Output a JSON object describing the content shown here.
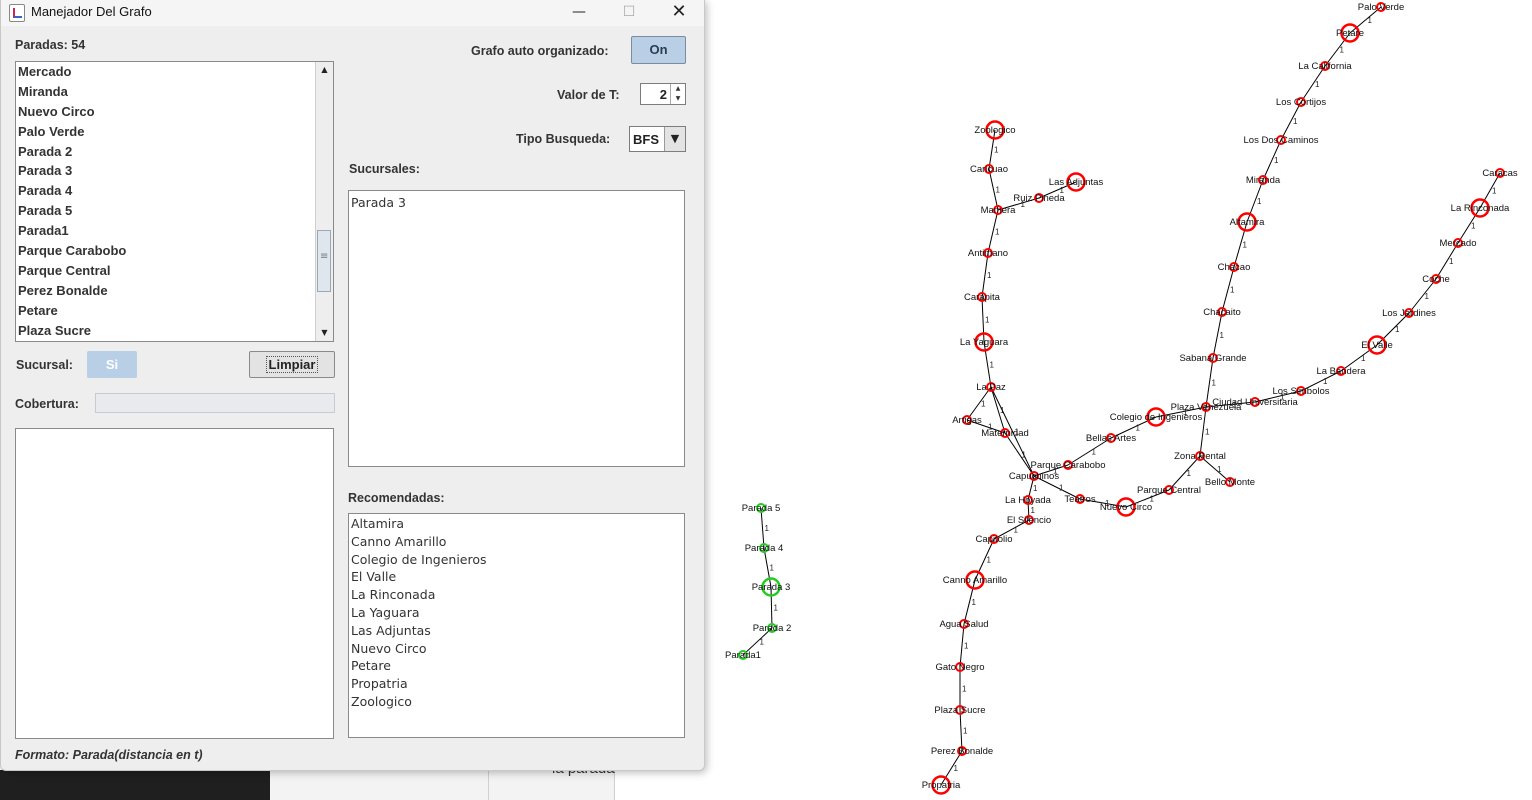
{
  "window": {
    "title": "Manejador Del Grafo",
    "controls": {
      "minimize": "—",
      "maximize": "☐",
      "close": "✕"
    }
  },
  "left": {
    "paradas_label": "Paradas: 54",
    "paradas_items": [
      "Mercado",
      "Miranda",
      "Nuevo Circo",
      "Palo Verde",
      "Parada 2",
      "Parada 3",
      "Parada 4",
      "Parada 5",
      "Parada1",
      "Parque Carabobo",
      "Parque Central",
      "Perez Bonalde",
      "Petare",
      "Plaza Sucre"
    ],
    "sucursal_label": "Sucursal:",
    "si_button": "Si",
    "limpiar_button": "Limpiar",
    "cobertura_label": "Cobertura:",
    "formato_text": "Formato: Parada(distancia en t)"
  },
  "right": {
    "auto_label": "Grafo auto organizado:",
    "auto_button": "On",
    "t_label": "Valor de T:",
    "t_value": "2",
    "tipo_label": "Tipo Busqueda:",
    "tipo_value": "BFS",
    "sucursales_label": "Sucursales:",
    "sucursales_items": [
      "Parada 3"
    ],
    "recomendadas_label": "Recomendadas:",
    "recomendadas_items": [
      "Altamira",
      "Canno Amarillo",
      "Colegio de Ingenieros",
      "El Valle",
      "La Rinconada",
      "La Yaguara",
      "Las Adjuntas",
      "Nuevo Circo",
      "Petare",
      "Propatria",
      "Zoologico"
    ]
  },
  "background": {
    "partial_text": "la parada"
  },
  "graph": {
    "colors": {
      "default": "#ff0000",
      "branch": "#22cc22"
    },
    "nodes": [
      {
        "id": "Palo Verde",
        "label": "Palo Verde",
        "big": false
      },
      {
        "id": "Petare",
        "label": "Petare",
        "big": true
      },
      {
        "id": "La California",
        "label": "La California",
        "big": false
      },
      {
        "id": "Los Cortijos",
        "label": "Los Cortijos",
        "big": false
      },
      {
        "id": "Los Dos Caminos",
        "label": "Los Dos Caminos",
        "big": false
      },
      {
        "id": "Miranda",
        "label": "Miranda",
        "big": false
      },
      {
        "id": "Altamira",
        "label": "Altamira",
        "big": true
      },
      {
        "id": "Chacao",
        "label": "Chacao",
        "big": false
      },
      {
        "id": "Chacaito",
        "label": "Chacaito",
        "big": false
      },
      {
        "id": "Sabana Grande",
        "label": "Sabana Grande",
        "big": false
      },
      {
        "id": "Plaza Venezuela",
        "label": "Plaza Venezuela",
        "big": false
      },
      {
        "id": "Colegio de Ingenieros",
        "label": "Colegio de Ingenieros",
        "big": true
      },
      {
        "id": "Bellas Artes",
        "label": "Bellas Artes",
        "big": false
      },
      {
        "id": "Parque Carabobo",
        "label": "Parque Carabobo",
        "big": false
      },
      {
        "id": "Capuchinos",
        "label": "Capuchinos",
        "big": false
      },
      {
        "id": "La Hoyada",
        "label": "La Hoyada",
        "big": false
      },
      {
        "id": "El Silencio",
        "label": "El Silencio",
        "big": false
      },
      {
        "id": "Capitolio",
        "label": "Capitolio",
        "big": false
      },
      {
        "id": "Canno Amarillo",
        "label": "Canno Amarillo",
        "big": true
      },
      {
        "id": "Agua Salud",
        "label": "Agua Salud",
        "big": false
      },
      {
        "id": "Gato Negro",
        "label": "Gato Negro",
        "big": false
      },
      {
        "id": "Plaza Sucre",
        "label": "Plaza Sucre",
        "big": false
      },
      {
        "id": "Perez Bonalde",
        "label": "Perez Bonalde",
        "big": false
      },
      {
        "id": "Propatria",
        "label": "Propatria",
        "big": true
      },
      {
        "id": "Teatros",
        "label": "Teatros",
        "big": false
      },
      {
        "id": "Nuevo Circo",
        "label": "Nuevo Circo",
        "big": true
      },
      {
        "id": "Parque Central",
        "label": "Parque Central",
        "big": false
      },
      {
        "id": "Zona Rental",
        "label": "Zona Rental",
        "big": false
      },
      {
        "id": "Bello Monte",
        "label": "Bello Monte",
        "big": false
      },
      {
        "id": "Ciudad Universitaria",
        "label": "Ciudad Universitaria",
        "big": false
      },
      {
        "id": "Los Simbolos",
        "label": "Los Simbolos",
        "big": false
      },
      {
        "id": "La Bandera",
        "label": "La Bandera",
        "big": false
      },
      {
        "id": "El Valle",
        "label": "El Valle",
        "big": true
      },
      {
        "id": "Los Jardines",
        "label": "Los Jardines",
        "big": false
      },
      {
        "id": "Coche",
        "label": "Coche",
        "big": false
      },
      {
        "id": "Mercado",
        "label": "Mercado",
        "big": false
      },
      {
        "id": "La Rinconada",
        "label": "La Rinconada",
        "big": true
      },
      {
        "id": "Caracas",
        "label": "Caracas",
        "big": false
      },
      {
        "id": "Zoologico",
        "label": "Zoologico",
        "big": true
      },
      {
        "id": "Caricuao",
        "label": "Caricuao",
        "big": false
      },
      {
        "id": "Mamera",
        "label": "Mamera",
        "big": false
      },
      {
        "id": "Ruiz Pineda",
        "label": "Ruiz Pineda",
        "big": false
      },
      {
        "id": "Las Adjuntas",
        "label": "Las Adjuntas",
        "big": true
      },
      {
        "id": "Antimano",
        "label": "Antimano",
        "big": false
      },
      {
        "id": "Carapita",
        "label": "Carapita",
        "big": false
      },
      {
        "id": "La Yaguara",
        "label": "La Yaguara",
        "big": true
      },
      {
        "id": "La Paz",
        "label": "La Paz",
        "big": false
      },
      {
        "id": "Artigas",
        "label": "Artigas",
        "big": false
      },
      {
        "id": "Maternidad",
        "label": "Maternidad",
        "big": false
      },
      {
        "id": "Parada 5",
        "label": "Parada 5",
        "big": false,
        "green": true
      },
      {
        "id": "Parada 4",
        "label": "Parada 4",
        "big": false,
        "green": true
      },
      {
        "id": "Parada 3",
        "label": "Parada 3",
        "big": true,
        "green": true
      },
      {
        "id": "Parada 2",
        "label": "Parada 2",
        "big": false,
        "green": true
      },
      {
        "id": "Parada1",
        "label": "Parada1",
        "big": false,
        "green": true
      }
    ],
    "edges": [
      [
        "Palo Verde",
        "Petare"
      ],
      [
        "Petare",
        "La California"
      ],
      [
        "La California",
        "Los Cortijos"
      ],
      [
        "Los Cortijos",
        "Los Dos Caminos"
      ],
      [
        "Los Dos Caminos",
        "Miranda"
      ],
      [
        "Miranda",
        "Altamira"
      ],
      [
        "Altamira",
        "Chacao"
      ],
      [
        "Chacao",
        "Chacaito"
      ],
      [
        "Chacaito",
        "Sabana Grande"
      ],
      [
        "Sabana Grande",
        "Plaza Venezuela"
      ],
      [
        "Plaza Venezuela",
        "Colegio de Ingenieros"
      ],
      [
        "Colegio de Ingenieros",
        "Bellas Artes"
      ],
      [
        "Bellas Artes",
        "Parque Carabobo"
      ],
      [
        "Parque Carabobo",
        "Capuchinos"
      ],
      [
        "Capuchinos",
        "La Hoyada"
      ],
      [
        "La Hoyada",
        "El Silencio"
      ],
      [
        "El Silencio",
        "Capitolio"
      ],
      [
        "Capitolio",
        "Canno Amarillo"
      ],
      [
        "Canno Amarillo",
        "Agua Salud"
      ],
      [
        "Agua Salud",
        "Gato Negro"
      ],
      [
        "Gato Negro",
        "Plaza Sucre"
      ],
      [
        "Plaza Sucre",
        "Perez Bonalde"
      ],
      [
        "Perez Bonalde",
        "Propatria"
      ],
      [
        "Capuchinos",
        "Teatros"
      ],
      [
        "Teatros",
        "Nuevo Circo"
      ],
      [
        "Nuevo Circo",
        "Parque Central"
      ],
      [
        "Parque Central",
        "Zona Rental"
      ],
      [
        "Zona Rental",
        "Plaza Venezuela"
      ],
      [
        "Zona Rental",
        "Bello Monte"
      ],
      [
        "Plaza Venezuela",
        "Ciudad Universitaria"
      ],
      [
        "Ciudad Universitaria",
        "Los Simbolos"
      ],
      [
        "Los Simbolos",
        "La Bandera"
      ],
      [
        "La Bandera",
        "El Valle"
      ],
      [
        "El Valle",
        "Los Jardines"
      ],
      [
        "Los Jardines",
        "Coche"
      ],
      [
        "Coche",
        "Mercado"
      ],
      [
        "Mercado",
        "La Rinconada"
      ],
      [
        "La Rinconada",
        "Caracas"
      ],
      [
        "Zoologico",
        "Caricuao"
      ],
      [
        "Caricuao",
        "Mamera"
      ],
      [
        "Mamera",
        "Ruiz Pineda"
      ],
      [
        "Ruiz Pineda",
        "Las Adjuntas"
      ],
      [
        "Mamera",
        "Antimano"
      ],
      [
        "Antimano",
        "Carapita"
      ],
      [
        "Carapita",
        "La Yaguara"
      ],
      [
        "La Yaguara",
        "La Paz"
      ],
      [
        "La Paz",
        "Artigas"
      ],
      [
        "La Paz",
        "Maternidad"
      ],
      [
        "Artigas",
        "Maternidad"
      ],
      [
        "Maternidad",
        "Capuchinos"
      ],
      [
        "La Paz",
        "Capuchinos"
      ],
      [
        "Parada 5",
        "Parada 4"
      ],
      [
        "Parada 4",
        "Parada 3"
      ],
      [
        "Parada 3",
        "Parada 2"
      ],
      [
        "Parada 2",
        "Parada1"
      ]
    ]
  }
}
